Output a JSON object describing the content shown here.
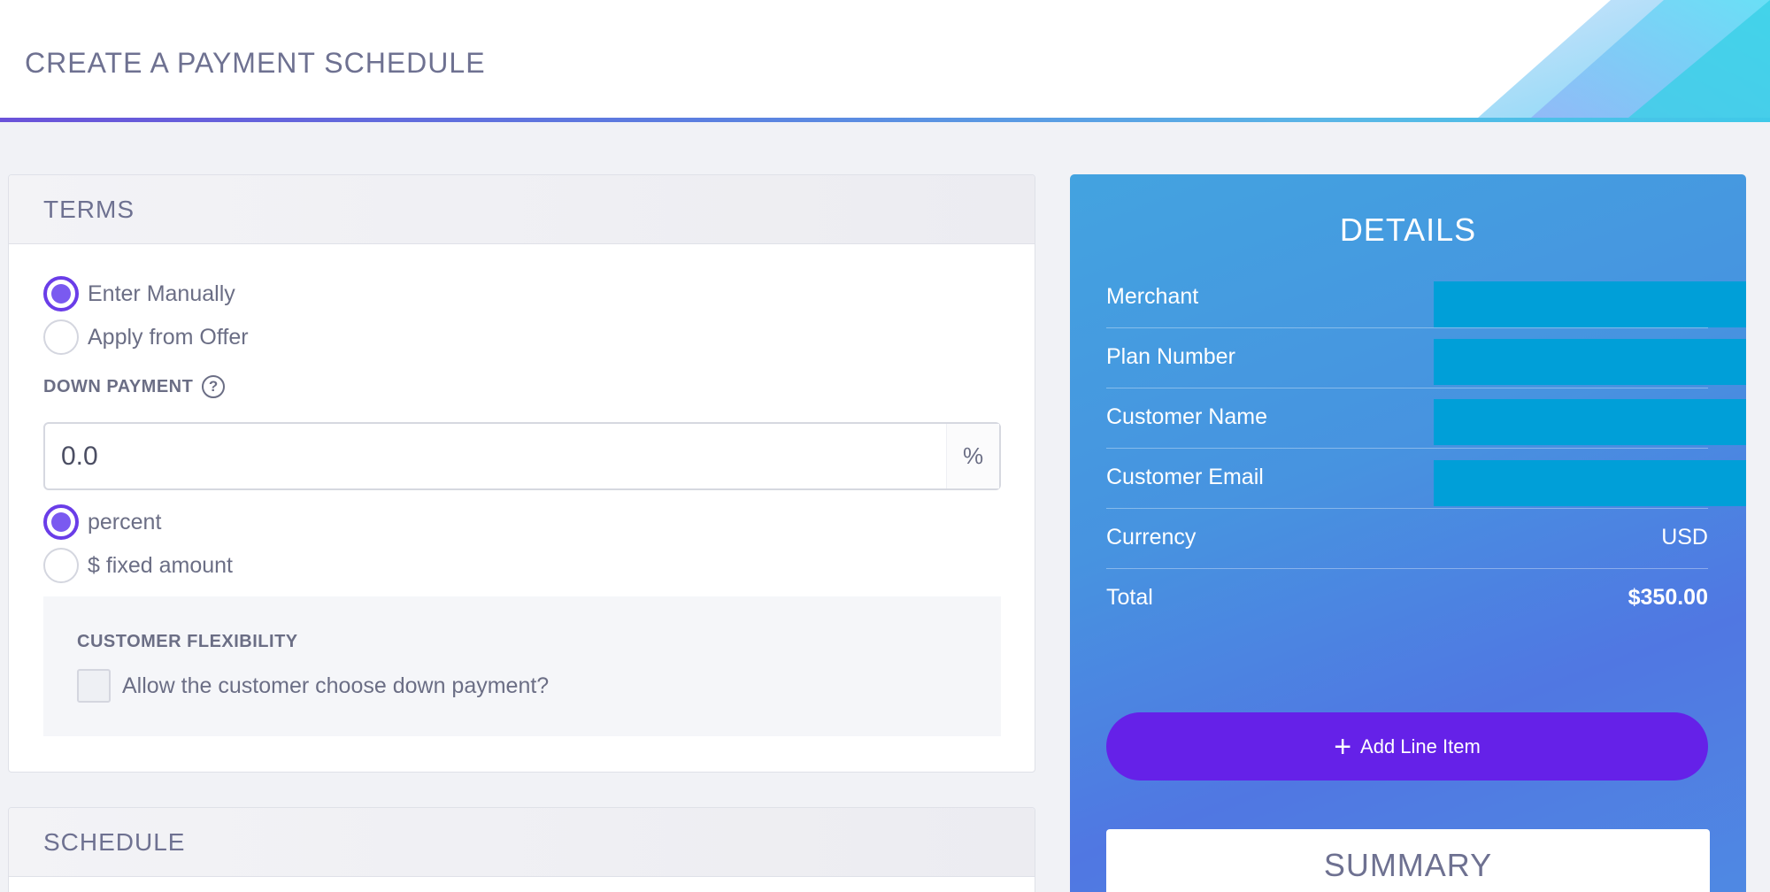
{
  "header": {
    "title": "CREATE A PAYMENT SCHEDULE"
  },
  "terms": {
    "title": "TERMS",
    "options": [
      {
        "label": "Enter Manually",
        "checked": true
      },
      {
        "label": "Apply from Offer",
        "checked": false
      }
    ],
    "down_payment": {
      "label": "DOWN PAYMENT",
      "help": "?",
      "value": "0.0",
      "suffix": "%",
      "types": [
        {
          "label": "percent",
          "checked": true
        },
        {
          "label": "$ fixed amount",
          "checked": false
        }
      ]
    },
    "flexibility": {
      "label": "CUSTOMER FLEXIBILITY",
      "checkbox_label": "Allow the customer choose down payment?",
      "checked": false
    }
  },
  "schedule": {
    "title": "SCHEDULE"
  },
  "details": {
    "title": "DETAILS",
    "rows": [
      {
        "label": "Merchant",
        "value": ""
      },
      {
        "label": "Plan Number",
        "value": ""
      },
      {
        "label": "Customer Name",
        "value": ""
      },
      {
        "label": "Customer Email",
        "value": ""
      },
      {
        "label": "Currency",
        "value": "USD"
      },
      {
        "label": "Total",
        "value": "$350.00"
      }
    ],
    "add_button": {
      "icon": "+",
      "label": "Add Line Item"
    }
  },
  "summary": {
    "title": "SUMMARY"
  },
  "colors": {
    "accent": "#6521e8",
    "radio": "#6a3de8",
    "panel": "#4793e0",
    "redaction": "#009fd8"
  }
}
